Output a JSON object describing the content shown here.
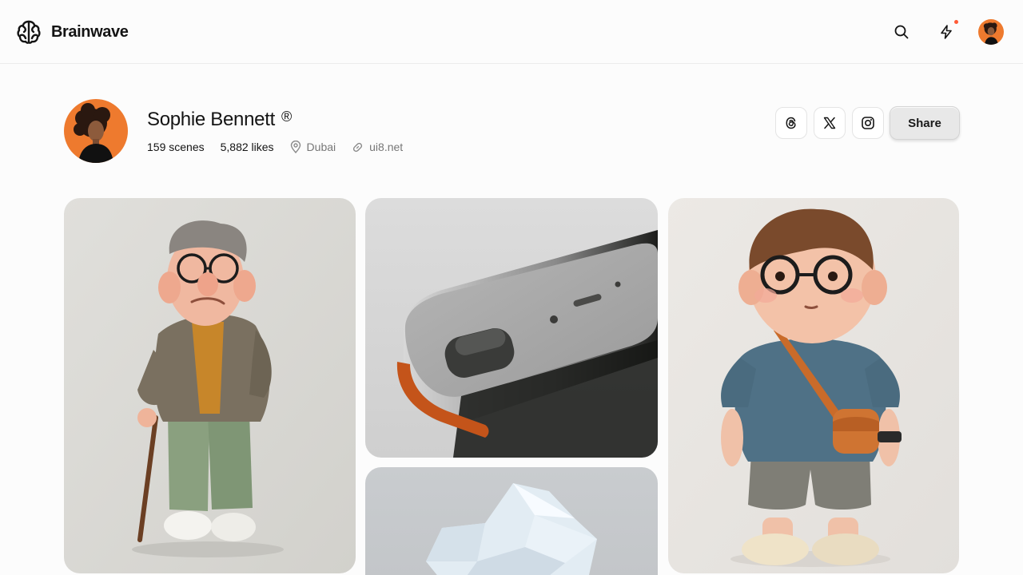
{
  "app": {
    "name": "Brainwave"
  },
  "header": {
    "icons": [
      "brain-logo-icon",
      "search-icon",
      "lightning-icon"
    ],
    "notification_color": "#ff5a36"
  },
  "profile": {
    "name": "Sophie Bennett",
    "verified_mark": "®",
    "scenes": "159 scenes",
    "likes": "5,882 likes",
    "location": "Dubai",
    "website": "ui8.net"
  },
  "actions": {
    "share_label": "Share",
    "social_icons": [
      "threads-icon",
      "x-icon",
      "instagram-icon"
    ]
  },
  "colors": {
    "accent": "#ee7a2e",
    "text": "#141414",
    "muted": "#777777",
    "border": "#e4e4e4"
  },
  "gallery": [
    {
      "subject": "old-man-figure"
    },
    {
      "subject": "device-render"
    },
    {
      "subject": "crystal-render"
    },
    {
      "subject": "boy-figure"
    }
  ]
}
